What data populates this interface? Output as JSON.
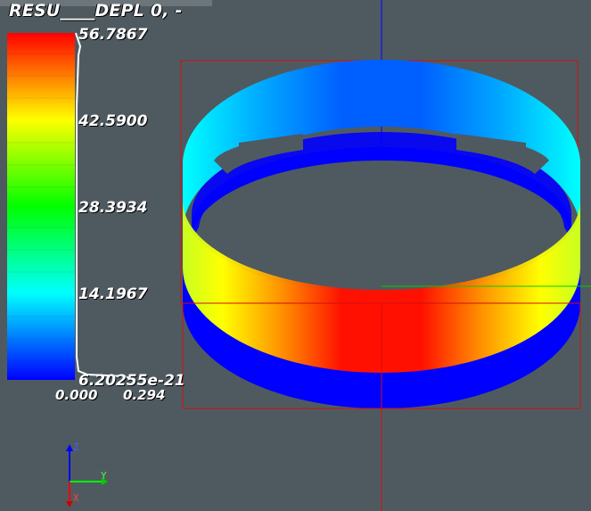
{
  "window": {
    "title": "RESU____DEPL 0, -"
  },
  "colorbar": {
    "tick_labels": [
      "56.7867",
      "42.5900",
      "28.3934",
      "14.1967",
      "6.20255e-21"
    ],
    "histogram_labels": [
      "0.000",
      "0.294"
    ],
    "colors": [
      "#ff0000",
      "#ffff00",
      "#00ff00",
      "#00ffff",
      "#0000ff"
    ]
  },
  "orientation_axes": {
    "x_label": "X",
    "y_label": "Y",
    "z_label": "Z",
    "x_color": "#ff0000",
    "y_color": "#00ff00",
    "z_color": "#0000ff"
  },
  "scene": {
    "background": "#4f5a60",
    "bbox_color": "#d01010"
  }
}
